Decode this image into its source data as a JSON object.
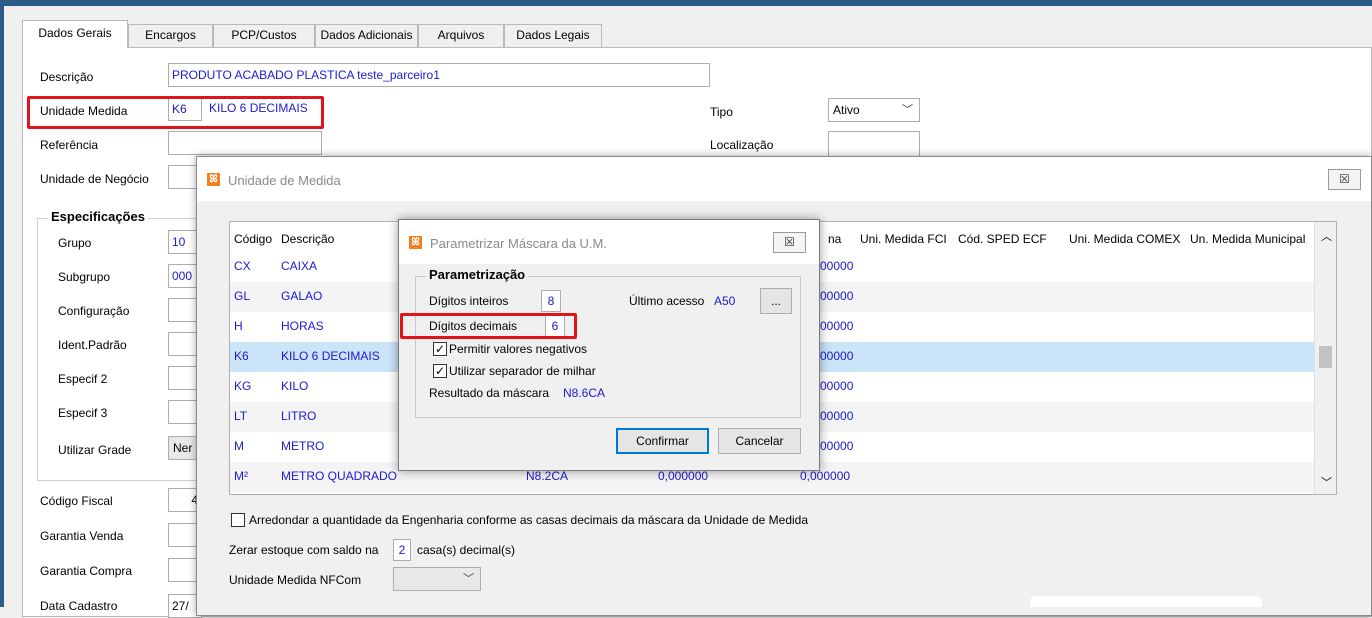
{
  "tabs": [
    "Dados Gerais",
    "Encargos",
    "PCP/Custos",
    "Dados Adicionais",
    "Arquivos",
    "Dados Legais"
  ],
  "form": {
    "descricao_label": "Descrição",
    "descricao_value": "PRODUTO ACABADO PLASTICA teste_parceiro1",
    "unidade_label": "Unidade Medida",
    "unidade_code": "K6",
    "unidade_desc": "KILO 6 DECIMAIS",
    "tipo_label": "Tipo",
    "tipo_value": "Ativo",
    "referencia_label": "Referência",
    "localizacao_label": "Localização",
    "negocio_label": "Unidade de Negócio",
    "espec_title": "Especificações",
    "grupo_label": "Grupo",
    "grupo_value": "10",
    "subgrupo_label": "Subgrupo",
    "subgrupo_value": "000",
    "config_label": "Configuração",
    "ident_label": "Ident.Padrão",
    "espec2_label": "Especif 2",
    "espec3_label": "Especif 3",
    "grade_label": "Utilizar Grade",
    "grade_value": "Ner",
    "fiscal_label": "Código Fiscal",
    "fiscal_value": "4",
    "garantia_venda_label": "Garantia Venda",
    "garantia_compra_label": "Garantia Compra",
    "data_cadastro_label": "Data Cadastro",
    "data_cadastro_value": "27/"
  },
  "dialog_um": {
    "title": "Unidade de Medida",
    "close": "☒",
    "headers": [
      "Código",
      "Descrição",
      "na",
      "Uni. Medida FCI",
      "Cód. SPED ECF",
      "Uni. Medida COMEX",
      "Un. Medida Municipal"
    ],
    "rows": [
      {
        "code": "CX",
        "desc": "CAIXA",
        "mask": "",
        "v1": "",
        "v2": "00000"
      },
      {
        "code": "GL",
        "desc": "GALAO",
        "mask": "",
        "v1": "",
        "v2": "00000"
      },
      {
        "code": "H",
        "desc": "HORAS",
        "mask": "",
        "v1": "",
        "v2": "00000"
      },
      {
        "code": "K6",
        "desc": "KILO 6 DECIMAIS",
        "mask": "",
        "v1": "",
        "v2": "00000"
      },
      {
        "code": "KG",
        "desc": "KILO",
        "mask": "",
        "v1": "",
        "v2": "00000"
      },
      {
        "code": "LT",
        "desc": "LITRO",
        "mask": "",
        "v1": "",
        "v2": "00000"
      },
      {
        "code": "M",
        "desc": "METRO",
        "mask": "",
        "v1": "",
        "v2": "00000"
      },
      {
        "code": "M²",
        "desc": "METRO QUADRADO",
        "mask": "N8.2CA",
        "v1": "0,000000",
        "v2": "0,000000"
      }
    ],
    "arredondar_label": "Arredondar a quantidade da Engenharia conforme as casas decimais da máscara da Unidade de Medida",
    "zerar_prefix": "Zerar estoque com saldo na",
    "zerar_value": "2",
    "zerar_suffix": "casa(s) decimal(s)",
    "nfcom_label": "Unidade Medida NFCom"
  },
  "dialog_mask": {
    "title": "Parametrizar Máscara da U.M.",
    "close": "☒",
    "group_title": "Parametrização",
    "inteiros_label": "Dígitos inteiros",
    "inteiros_value": "8",
    "ultimo_label": "Último acesso",
    "ultimo_value": "A50",
    "ellipsis": "...",
    "decimais_label": "Dígitos decimais",
    "decimais_value": "6",
    "negativos_label": "Permitir valores negativos",
    "milhar_label": "Utilizar separador de milhar",
    "resultado_label": "Resultado da máscara",
    "resultado_value": "N8.6CA",
    "confirmar_label": "Confirmar",
    "cancelar_label": "Cancelar"
  },
  "icons": [
    "app-logo-icon",
    "close-icon",
    "chevron-down-icon",
    "checkbox-checked-icon",
    "scroll-up-icon",
    "scroll-down-icon"
  ],
  "colors": {
    "accent_blue": "#1a1ad0",
    "highlight_red": "#e0151b",
    "selected_row": "#cce4f7",
    "window_border": "#2b5c8a"
  }
}
